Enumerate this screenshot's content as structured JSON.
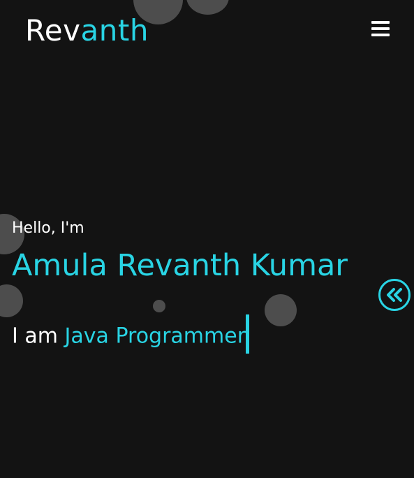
{
  "header": {
    "logo_part1": "Rev",
    "logo_part2": "anth",
    "menu_icon": "hamburger-menu-icon"
  },
  "hero": {
    "greeting": "Hello, I'm",
    "name": "Amula Revanth Kumar",
    "role_prefix": "I am",
    "role": "Java Programmer"
  },
  "side_button": {
    "icon": "double-chevron-left-icon"
  },
  "colors": {
    "background": "#131313",
    "accent": "#29d4e4",
    "text": "#ffffff",
    "bubble": "#585858"
  }
}
